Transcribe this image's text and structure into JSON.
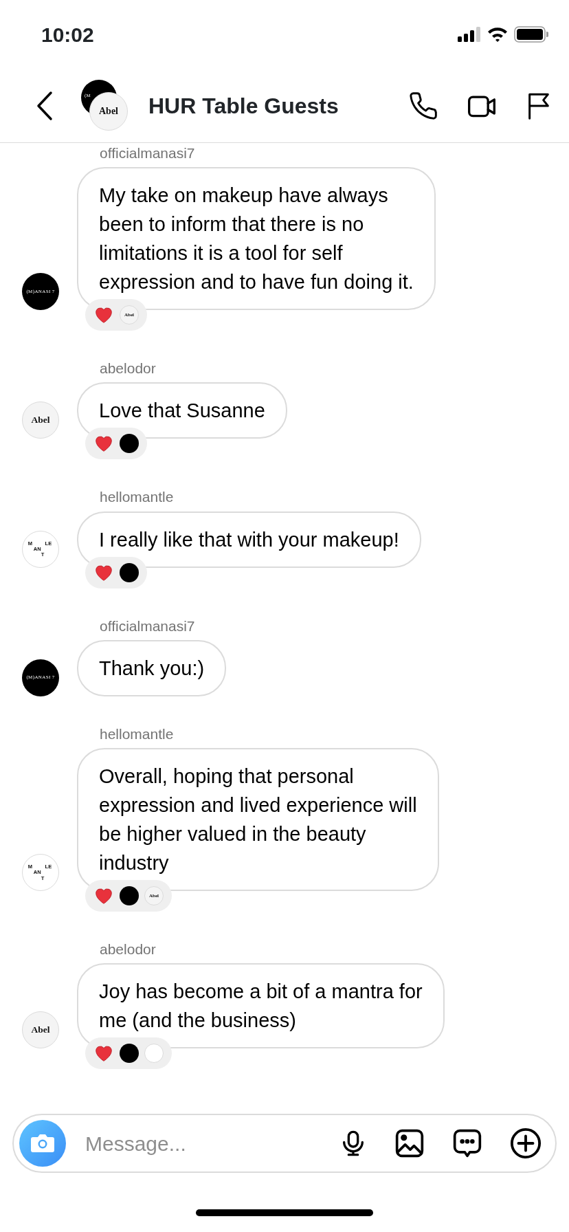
{
  "status_bar": {
    "time": "10:02"
  },
  "header": {
    "title": "HUR Table Guests",
    "group_avatars": [
      {
        "kind": "manasi",
        "text": "(M"
      },
      {
        "kind": "abel",
        "text": "Abel"
      }
    ]
  },
  "messages": [
    {
      "sender": "officialmanasi7",
      "avatar": {
        "kind": "manasi",
        "text": "(M)ANASI 7"
      },
      "text": "My take on makeup have always\nbeen to inform that there is no\nlimitations it is a tool for self\nexpression and to have fun doing it.",
      "reactions": [
        {
          "kind": "heart"
        },
        {
          "kind": "abel",
          "text": "Abel"
        }
      ]
    },
    {
      "sender": "abelodor",
      "avatar": {
        "kind": "abel",
        "text": "Abel"
      },
      "text": "Love that Susanne",
      "reactions": [
        {
          "kind": "heart"
        },
        {
          "kind": "manasi"
        }
      ]
    },
    {
      "sender": "hellomantle",
      "avatar": {
        "kind": "mantle",
        "text_parts": [
          "M",
          "AN",
          "T",
          "LE"
        ]
      },
      "text": "I really like that with your makeup!",
      "reactions": [
        {
          "kind": "heart"
        },
        {
          "kind": "manasi"
        }
      ]
    },
    {
      "sender": "officialmanasi7",
      "avatar": {
        "kind": "manasi",
        "text": "(M)ANASI 7"
      },
      "text": "Thank you:)"
    },
    {
      "sender": "hellomantle",
      "avatar": {
        "kind": "mantle",
        "text_parts": [
          "M",
          "AN",
          "T",
          "LE"
        ]
      },
      "text": "Overall, hoping that personal\nexpression and lived experience will\nbe higher valued in the beauty\nindustry",
      "reactions": [
        {
          "kind": "heart"
        },
        {
          "kind": "manasi"
        },
        {
          "kind": "abel",
          "text": "Abel"
        }
      ]
    },
    {
      "sender": "abelodor",
      "avatar": {
        "kind": "abel",
        "text": "Abel"
      },
      "text": "Joy has become a bit of a mantra for\nme (and the business)",
      "reactions": [
        {
          "kind": "heart"
        },
        {
          "kind": "manasi"
        },
        {
          "kind": "mantle"
        }
      ]
    }
  ],
  "composer": {
    "placeholder": "Message..."
  }
}
